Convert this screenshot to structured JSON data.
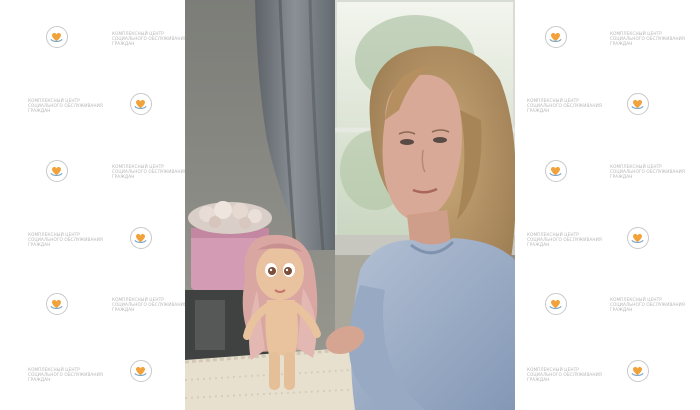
{
  "image": {
    "subject": "",
    "palette": {
      "background": "#ffffff",
      "wall": "#8a8b86",
      "curtain": "#6e7479",
      "window_light": "#e7efe3",
      "sweater": "#9fb0c8",
      "hair": "#b79667",
      "skin": "#d7a996",
      "doll_hair": "#d9a6a2",
      "doll_body": "#e8c39d",
      "pink_box": "#d39bb4",
      "lace": "#e8e0cf",
      "watermark_text": "#b6b6b6"
    }
  },
  "watermark": {
    "line1": "КОМПЛЕКСНЫЙ ЦЕНТР",
    "line2": "СОЦИАЛЬНОГО ОБСЛУЖИВАНИЯ",
    "line3": "ГРАЖДАН",
    "logo_icon": "heart-hands-icon"
  }
}
